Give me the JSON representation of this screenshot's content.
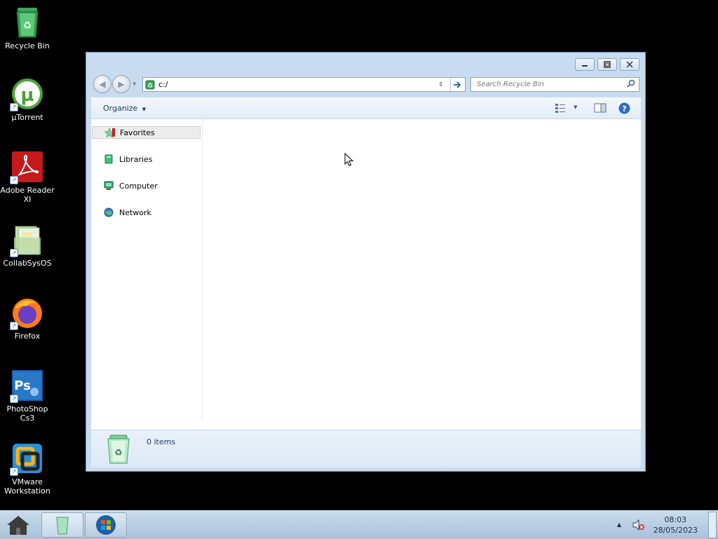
{
  "desktop": {
    "icons": [
      {
        "label": "Recycle Bin",
        "icon": "recycle-bin-icon"
      },
      {
        "label": "µTorrent",
        "icon": "utorrent-icon"
      },
      {
        "label": "Adobe Reader XI",
        "icon": "adobe-reader-icon"
      },
      {
        "label": "CollabSysOS",
        "icon": "folder-icon"
      },
      {
        "label": "Firefox",
        "icon": "firefox-icon"
      },
      {
        "label": "PhotoShop Cs3",
        "icon": "photoshop-icon"
      },
      {
        "label": "VMware Workstation",
        "icon": "vmware-icon"
      }
    ]
  },
  "window": {
    "address": {
      "value": "c:/"
    },
    "search": {
      "placeholder": "Search Recycle Bin"
    },
    "toolbar": {
      "organize_label": "Organize"
    },
    "nav": {
      "items": [
        {
          "label": "Favorites"
        },
        {
          "label": "Libraries"
        },
        {
          "label": "Computer"
        },
        {
          "label": "Network"
        }
      ]
    },
    "details": {
      "item_count": "0 items"
    }
  },
  "taskbar": {
    "clock": {
      "time": "08:03",
      "date": "28/05/2023"
    }
  },
  "colors": {
    "window_frame": "#c9dcef",
    "taskbar": "#b7cde2",
    "desktop": "#000000"
  }
}
